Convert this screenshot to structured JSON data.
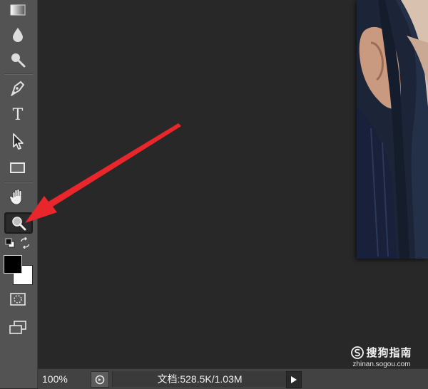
{
  "app": {
    "title": ""
  },
  "toolbar": {
    "tools": [
      "gradient-tool",
      "blur-tool",
      "dodge-tool",
      "pen-tool",
      "type-tool",
      "path-selection-tool",
      "rectangle-tool",
      "hand-tool",
      "zoom-tool"
    ],
    "type_tool_glyph": "T",
    "active_tool": "zoom-tool",
    "foreground_color": "#000000",
    "background_color": "#ffffff"
  },
  "status_bar": {
    "zoom": "100%",
    "doc_info": "文档:528.5K/1.03M"
  },
  "annotation": {
    "arrow_color": "#e8262b",
    "points_to": "zoom-tool"
  },
  "watermark": {
    "name": "搜狗指南",
    "url": "zhinan.sogou.com"
  }
}
